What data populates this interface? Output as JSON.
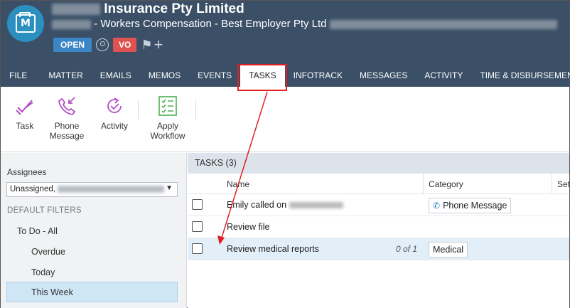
{
  "header": {
    "title_visible": "Insurance Pty Limited",
    "subtitle_visible": " - Workers Compensation - Best Employer Pty Ltd",
    "status_badge": "OPEN",
    "initials_badge": "VO"
  },
  "tabs": [
    {
      "label": "FILE"
    },
    {
      "label": "MATTER"
    },
    {
      "label": "EMAILS"
    },
    {
      "label": "MEMOS"
    },
    {
      "label": "EVENTS"
    },
    {
      "label": "TASKS"
    },
    {
      "label": "INFOTRACK"
    },
    {
      "label": "MESSAGES"
    },
    {
      "label": "ACTIVITY"
    },
    {
      "label": "TIME & DISBURSEMENTS"
    }
  ],
  "toolbar": {
    "task": "Task",
    "phone_line1": "Phone",
    "phone_line2": "Message",
    "activity": "Activity",
    "workflow_line1": "Apply",
    "workflow_line2": "Workflow"
  },
  "sidebar": {
    "assignees_label": "Assignees",
    "assignees_value": "Unassigned,",
    "filters_heading": "DEFAULT FILTERS",
    "filters": [
      {
        "label": "To Do - All"
      },
      {
        "label": "Overdue"
      },
      {
        "label": "Today"
      },
      {
        "label": "This Week"
      }
    ]
  },
  "tasks": {
    "heading": "TASKS (3)",
    "columns": {
      "name": "Name",
      "category": "Category",
      "setting": "Set"
    },
    "rows": [
      {
        "name": "Emily called on",
        "progress": "",
        "category": "Phone Message"
      },
      {
        "name": "Review file",
        "progress": "",
        "category": ""
      },
      {
        "name": "Review medical reports",
        "progress": "0 of 1",
        "category": "Medical"
      }
    ]
  },
  "colors": {
    "header_bg": "#3b5067",
    "accent_blue": "#2b8fc0",
    "open_badge": "#3b86c6",
    "vo_badge": "#e05252",
    "annotation_red": "#e02020",
    "selected_filter": "#cfe6f7",
    "highlight_row": "#e2eef8"
  }
}
